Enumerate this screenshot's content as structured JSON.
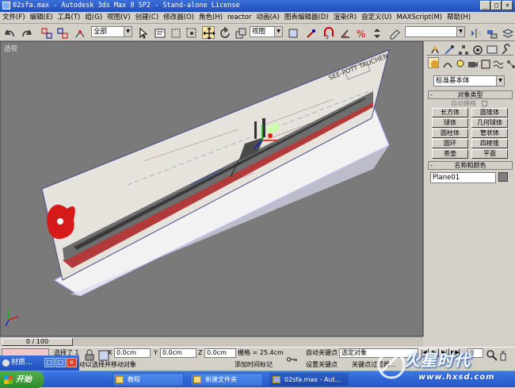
{
  "window": {
    "title": "02sfa.max - Autodesk 3ds Max 8 SP2 - Stand-alone License",
    "min_label": "_",
    "max_label": "□",
    "close_label": "×"
  },
  "menu": [
    "文件(F)",
    "编辑(E)",
    "工具(T)",
    "组(G)",
    "视图(V)",
    "创建(C)",
    "修改器(O)",
    "角色(H)",
    "reactor",
    "动画(A)",
    "图表编辑器(D)",
    "渲染(R)",
    "自定义(U)",
    "MAXScript(M)",
    "帮助(H)"
  ],
  "toolbar": {
    "selection_filter": "全部",
    "ref_coord": "视图",
    "named_selection": ""
  },
  "viewport": {
    "label": "透视",
    "poster_text": "SEE-POTT TAUCHEN"
  },
  "command_panel": {
    "category": "标准基本体",
    "object_type_header": "对象类型",
    "autogrid_label": "自动栅格",
    "buttons": [
      "长方体",
      "圆锥体",
      "球体",
      "几何球体",
      "圆柱体",
      "管状体",
      "圆环",
      "四棱锥",
      "茶壶",
      "平面"
    ],
    "name_color_header": "名称和颜色",
    "object_name": "Plane01",
    "object_color": "#7f7f7f"
  },
  "timeline": {
    "position": "0 / 100",
    "position_fraction": 0.0
  },
  "statusbar": {
    "selected": "选择了 1",
    "x_label": "X",
    "x": "0.0cm",
    "y_label": "Y",
    "y": "0.0cm",
    "z_label": "Z",
    "z": "0.0cm",
    "grid": "栅格 = 25.4cm",
    "auto_key": "自动关键点",
    "selected_object": "选定对象",
    "set_key": "设置关键点",
    "key_filters": "关键点过滤器...",
    "frame": "0",
    "prompt": "动以选择并移动对象",
    "add_time_tag": "添加时间标记"
  },
  "popup": {
    "label": "材质..."
  },
  "taskbar": {
    "start": "开始",
    "items": [
      "教程",
      "新建文件夹",
      "02sfa.max - Aut..."
    ]
  },
  "watermark": {
    "title": "火星时代",
    "url": "www.hxsd.com"
  }
}
